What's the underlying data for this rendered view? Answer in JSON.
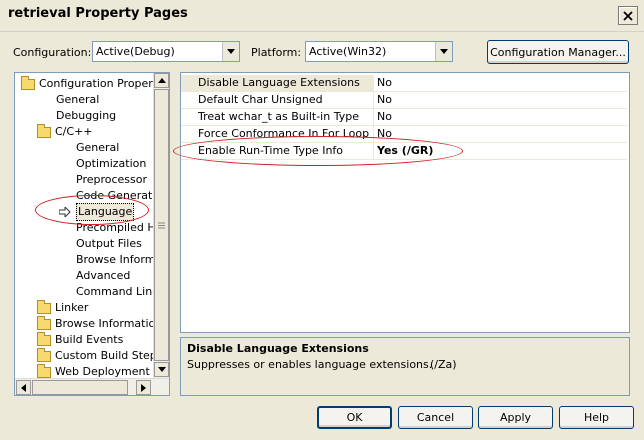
{
  "window": {
    "title": "retrieval Property Pages"
  },
  "toolbar": {
    "configuration_label": "Configuration:",
    "configuration_value": "Active(Debug)",
    "platform_label": "Platform:",
    "platform_value": "Active(Win32)",
    "config_manager_label": "Configuration Manager..."
  },
  "tree": {
    "items": [
      {
        "label": "Configuration Properties"
      },
      {
        "label": "General"
      },
      {
        "label": "Debugging"
      },
      {
        "label": "C/C++"
      },
      {
        "label": "General"
      },
      {
        "label": "Optimization"
      },
      {
        "label": "Preprocessor"
      },
      {
        "label": "Code Generation"
      },
      {
        "label": "Language"
      },
      {
        "label": "Precompiled Headers"
      },
      {
        "label": "Output Files"
      },
      {
        "label": "Browse Information"
      },
      {
        "label": "Advanced"
      },
      {
        "label": "Command Line"
      },
      {
        "label": "Linker"
      },
      {
        "label": "Browse Information"
      },
      {
        "label": "Build Events"
      },
      {
        "label": "Custom Build Step"
      },
      {
        "label": "Web Deployment"
      }
    ]
  },
  "properties": {
    "rows": [
      {
        "name": "Disable Language Extensions",
        "value": "No"
      },
      {
        "name": "Default Char Unsigned",
        "value": "No"
      },
      {
        "name": "Treat wchar_t as Built-in Type",
        "value": "No"
      },
      {
        "name": "Force Conformance In For Loop Scope",
        "value": "No"
      },
      {
        "name": "Enable Run-Time Type Info",
        "value": "Yes (/GR)"
      }
    ]
  },
  "description": {
    "title": "Disable Language Extensions",
    "text": "Suppresses or enables language extensions.",
    "switch": "(/Za)"
  },
  "buttons": {
    "ok": "OK",
    "cancel": "Cancel",
    "apply": "Apply",
    "help": "Help"
  },
  "colors": {
    "highlight_ellipse": "#d42020",
    "selection": "#ece9d8",
    "window_bg": "#ece9d8"
  }
}
